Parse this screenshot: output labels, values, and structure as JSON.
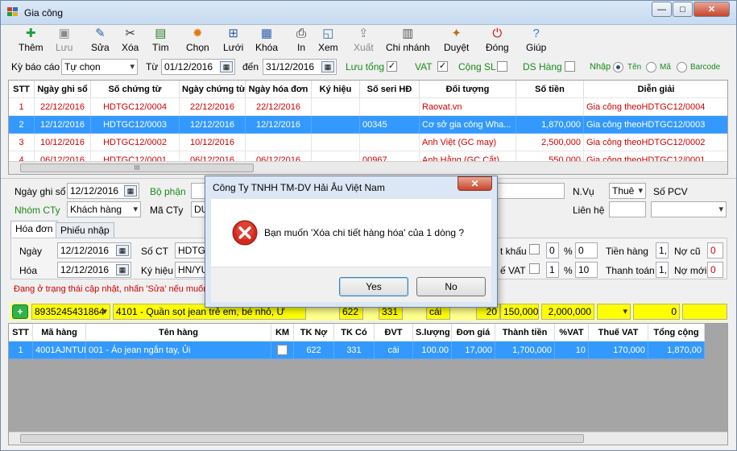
{
  "window": {
    "title": "Gia công",
    "min": "—",
    "max": "□",
    "close": "✕"
  },
  "toolbar": [
    {
      "name": "them-button",
      "icon": "add-icon",
      "label": "Thêm",
      "enabled": true,
      "color": "#1e9e3a",
      "glyph": "✚"
    },
    {
      "name": "luu-button",
      "icon": "save-icon",
      "label": "Lưu",
      "enabled": false,
      "color": "#8a8a8a",
      "glyph": "▣"
    },
    {
      "name": "sua-button",
      "icon": "pencil-icon",
      "label": "Sửa",
      "enabled": true,
      "color": "#2a5fb0",
      "glyph": "✎"
    },
    {
      "name": "xoa-button",
      "icon": "scissors-icon",
      "label": "Xóa",
      "enabled": true,
      "color": "#333333",
      "glyph": "✂"
    },
    {
      "name": "tim-button",
      "icon": "find-icon",
      "label": "Tìm",
      "enabled": true,
      "color": "#2e7d32",
      "glyph": "▤"
    },
    {
      "name": "chon-button",
      "icon": "gear-icon",
      "label": "Chọn",
      "enabled": true,
      "color": "#e07a10",
      "glyph": "✹"
    },
    {
      "name": "luoi-button",
      "icon": "grid-icon",
      "label": "Lưới",
      "enabled": true,
      "color": "#2a5fb0",
      "glyph": "⊞"
    },
    {
      "name": "khoa-button",
      "icon": "lock-grid-icon",
      "label": "Khóa",
      "enabled": true,
      "color": "#2a5fb0",
      "glyph": "▦"
    },
    {
      "name": "in-button",
      "icon": "printer-icon",
      "label": "In",
      "enabled": true,
      "color": "#222222",
      "glyph": "⎙"
    },
    {
      "name": "xem-button",
      "icon": "preview-icon",
      "label": "Xem",
      "enabled": true,
      "color": "#3a6ea5",
      "glyph": "◱"
    },
    {
      "name": "xuat-button",
      "icon": "export-icon",
      "label": "Xuất",
      "enabled": false,
      "color": "#8a8a8a",
      "glyph": "⇪"
    },
    {
      "name": "chi-nhanh-button",
      "icon": "building-icon",
      "label": "Chi nhánh",
      "enabled": true,
      "color": "#555555",
      "glyph": "▥"
    },
    {
      "name": "duyet-button",
      "icon": "stamp-icon",
      "label": "Duyệt",
      "enabled": true,
      "color": "#b3741a",
      "glyph": "✦"
    },
    {
      "name": "dong-button",
      "icon": "power-icon",
      "label": "Đóng",
      "enabled": true,
      "color": "#d01010",
      "glyph": "⏻"
    },
    {
      "name": "giup-button",
      "icon": "help-icon",
      "label": "Giúp",
      "enabled": true,
      "color": "#2a7fd0",
      "glyph": "?"
    }
  ],
  "filter": {
    "ky_bao_cao_label": "Kỳ báo cáo",
    "ky_bao_cao_value": "Tự chọn",
    "tu_label": "Từ",
    "tu_value": "01/12/2016",
    "den_label": "đến",
    "den_value": "31/12/2016",
    "luu_tong_label": "Lưu tổng",
    "luu_tong_checked": true,
    "vat_label": "VAT",
    "vat_checked": true,
    "cong_sl_label": "Cộng SL",
    "cong_sl_checked": false,
    "ds_hang_label": "DS Hàng",
    "ds_hang_checked": false,
    "nhap_label": "Nhập",
    "ten_label": "Tên",
    "ma_label": "Mã",
    "barcode_label": "Barcode",
    "selected_radio": "Tên"
  },
  "top_grid": {
    "columns": [
      "STT",
      "Ngày ghi sổ",
      "Số chứng từ",
      "Ngày chứng từ",
      "Ngày hóa đơn",
      "Ký hiệu",
      "Số seri HĐ",
      "Đối tượng",
      "Số tiền",
      "Diễn giải"
    ],
    "rows": [
      {
        "style": "red",
        "cells": [
          "1",
          "22/12/2016",
          "HDTGC12/0004",
          "22/12/2016",
          "22/12/2016",
          "",
          "",
          "Raovat.vn",
          "",
          "Gia công theoHDTGC12/0004"
        ]
      },
      {
        "style": "sel",
        "cells": [
          "2",
          "12/12/2016",
          "HDTGC12/0003",
          "12/12/2016",
          "12/12/2016",
          "",
          "00345",
          "Cơ sở gia công Wha...",
          "1,870,000",
          "Gia công theoHDTGC12/0003"
        ]
      },
      {
        "style": "red",
        "cells": [
          "3",
          "10/12/2016",
          "HDTGC12/0002",
          "10/12/2016",
          "",
          "",
          "",
          "Anh Việt (GC may)",
          "2,500,000",
          "Gia công theoHDTGC12/0002"
        ]
      },
      {
        "style": "red",
        "cells": [
          "4",
          "06/12/2016",
          "HDTGC12/0001",
          "06/12/2016",
          "06/12/2016",
          "",
          "00967",
          "Anh Hằng (GC Cắt)",
          "550,000",
          "Gia công theoHDTGC12/0001"
        ]
      }
    ],
    "scroll_grip": "III"
  },
  "form": {
    "ngay_ghi_so_label": "Ngày ghi sổ",
    "ngay_ghi_so_value": "12/12/2016",
    "bo_phan_label": "Bộ phận",
    "nhom_cty_label": "Nhóm CTy",
    "nhom_cty_value": "Khách hàng",
    "ma_cty_label": "Mã CTy",
    "ma_cty_value": "DU",
    "nvu_label": "N.Vụ",
    "nvu_value": "Thuê",
    "so_pcv_label": "Số PCV",
    "lien_he_label": "Liên hệ",
    "tabs": [
      "Hóa đơn",
      "Phiếu nhập"
    ],
    "ngay_label": "Ngày",
    "ngay_value": "12/12/2016",
    "so_ct_label": "Số CT",
    "so_ct_value": "HDTGC",
    "hoa_label": "Hóa",
    "hoa_value": "12/12/2016",
    "ky_hieu_label": "Ký hiệu",
    "ky_hieu_value": "HN/YU",
    "chiet_khau_label": "t khấu",
    "chiet_khau_a": "0",
    "chiet_khau_b": "0",
    "pct1": "%",
    "vat_label": "ế VAT",
    "vat_a": "1",
    "vat_b": "10",
    "pct2": "%",
    "tien_hang_label": "Tiền hàng",
    "tien_hang_value": "1,",
    "thanh_toan_label": "Thanh toán",
    "thanh_toan_value": "1,",
    "no_cu_label": "Nợ cũ",
    "no_cu_value": "0",
    "no_moi_label": "Nợ mới",
    "no_moi_value": "0",
    "status_text": "Đang ở trạng thái cập nhật, nhấn 'Sửa' nếu muốn lư"
  },
  "entry_line": {
    "barcode_value": "8935245431864",
    "item_value": "4101 - Quần sọt jean trẻ em, bé nhỏ, Ừ",
    "hidden_a": "622",
    "hidden_b": "331",
    "hidden_c": "cái",
    "hidden_d": "20",
    "price_value": "150,000",
    "amount_value": "2,000,000",
    "tax_value": "0"
  },
  "detail_grid": {
    "columns": [
      "STT",
      "Mã hàng",
      "Tên hàng",
      "KM",
      "TK Nợ",
      "TK Có",
      "ĐVT",
      "S.lượng",
      "Đơn giá",
      "Thành tiền",
      "%VAT",
      "Thuế VAT",
      "Tổng cộng"
    ],
    "rows": [
      {
        "style": "sel",
        "km_checked": false,
        "cells": [
          "1",
          "4001AJNTUI",
          "001 - Áo jean ngắn tay, Ủi",
          "",
          "622",
          "331",
          "cái",
          "100.00",
          "17,000",
          "1,700,000",
          "10",
          "170,000",
          "1,870,00"
        ]
      }
    ]
  },
  "dialog": {
    "title": "Công Ty TNHH TM-DV Hải Âu Việt Nam",
    "close": "✕",
    "message": "Bạn muốn 'Xóa chi tiết hàng hóa' của 1 dòng ?",
    "yes_label": "Yes",
    "no_label": "No"
  }
}
